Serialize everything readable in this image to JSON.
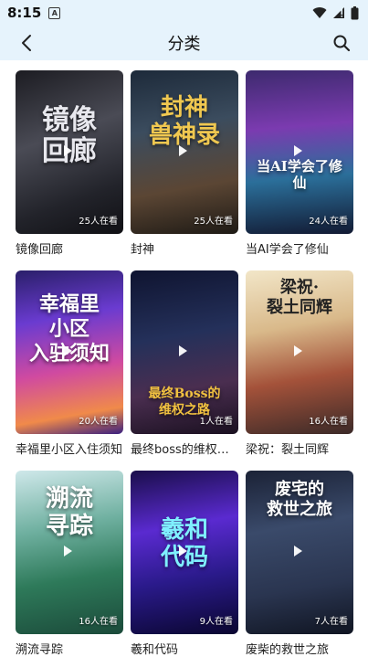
{
  "status_bar": {
    "time": "8:15",
    "notif_label": "A"
  },
  "header": {
    "title": "分类",
    "back_icon": "chevron-left-icon",
    "search_icon": "search-icon"
  },
  "accent_color": "#e6f3fc",
  "cards": [
    {
      "title": "镜像回廊",
      "viewers": "25人在看",
      "cover_text": "镜像\n回廊"
    },
    {
      "title": "封神",
      "viewers": "25人在看",
      "cover_text": "封神\n兽神录"
    },
    {
      "title": "当AI学会了修仙",
      "viewers": "24人在看",
      "cover_text": "当AI学会了修仙"
    },
    {
      "title": "幸福里小区入住须知",
      "viewers": "20人在看",
      "cover_text": "幸福里\n小区\n入驻须知"
    },
    {
      "title": "最终boss的维权之路",
      "viewers": "1人在看",
      "cover_text": "最终Boss的\n维权之路"
    },
    {
      "title": "梁祝：裂土同辉",
      "viewers": "16人在看",
      "cover_text": "梁祝·\n裂土同辉"
    },
    {
      "title": "溯流寻踪",
      "viewers": "16人在看",
      "cover_text": "溯流\n寻踪"
    },
    {
      "title": "羲和代码",
      "viewers": "9人在看",
      "cover_text": "羲和\n代码"
    },
    {
      "title": "废柴的救世之旅",
      "viewers": "7人在看",
      "cover_text": "废宅的\n救世之旅"
    }
  ]
}
